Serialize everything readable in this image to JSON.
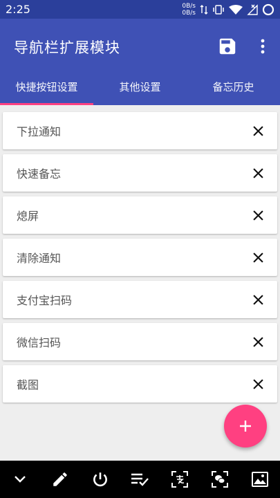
{
  "status_bar": {
    "time": "2:25",
    "net_up": "0B/s",
    "net_down": "0B/s",
    "icons": [
      "data-transfer-icon",
      "vibrate-icon",
      "wifi-icon",
      "no-signal-icon",
      "circle-icon"
    ]
  },
  "app_bar": {
    "title": "导航栏扩展模块",
    "actions": [
      "save-icon",
      "more-vert-icon"
    ]
  },
  "tabs": [
    {
      "label": "快捷按钮设置",
      "active": true
    },
    {
      "label": "其他设置",
      "active": false
    },
    {
      "label": "备忘历史",
      "active": false
    }
  ],
  "items": [
    {
      "label": "下拉通知"
    },
    {
      "label": "快速备忘"
    },
    {
      "label": "熄屏"
    },
    {
      "label": "清除通知"
    },
    {
      "label": "支付宝扫码"
    },
    {
      "label": "微信扫码"
    },
    {
      "label": "截图"
    }
  ],
  "fab": {
    "icon": "plus-icon"
  },
  "nav_bar": {
    "icons": [
      "chevron-down-icon",
      "pencil-icon",
      "power-icon",
      "checklist-icon",
      "scan-alipay-icon",
      "scan-wechat-icon",
      "screenshot-icon"
    ]
  },
  "colors": {
    "status_bar": "#2b3f9b",
    "primary": "#3f51b5",
    "accent": "#ff4081",
    "background": "#eeeeee",
    "nav_bar": "#000000"
  }
}
